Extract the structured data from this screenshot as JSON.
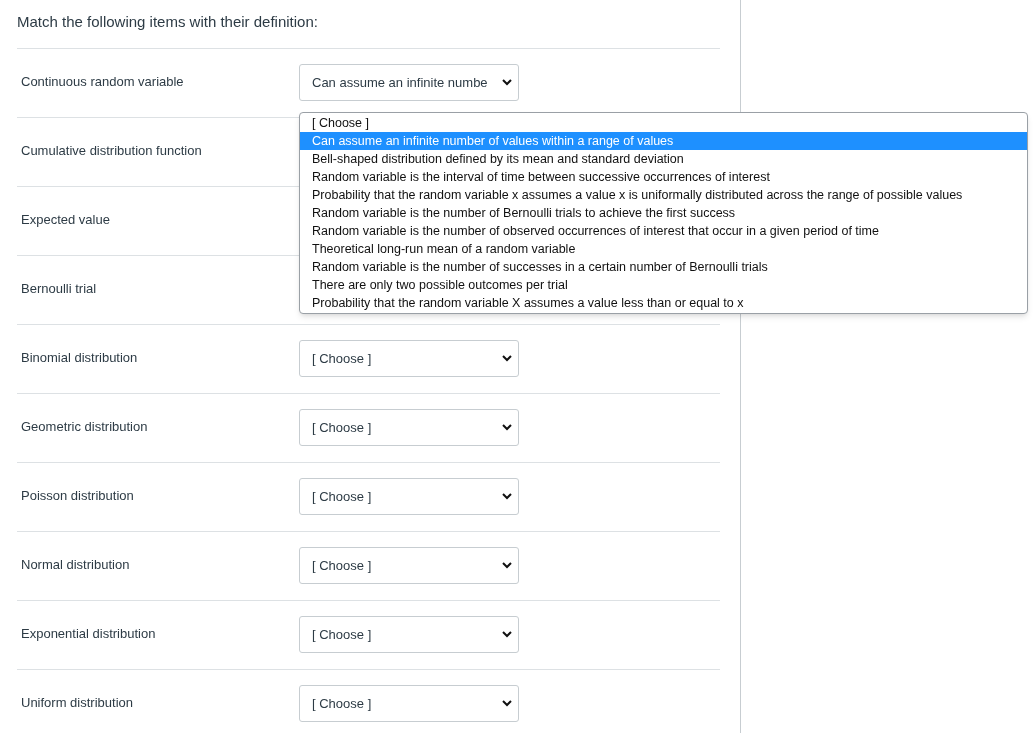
{
  "question": "Match the following items with their definition:",
  "items": [
    {
      "label": "Continuous random variable",
      "kind": "select",
      "value": "Can assume an infinite numbe"
    },
    {
      "label": "Cumulative distribution function",
      "kind": "covered"
    },
    {
      "label": "Expected value",
      "kind": "covered"
    },
    {
      "label": "Bernoulli trial",
      "kind": "covered"
    },
    {
      "label": "Binomial distribution",
      "kind": "select",
      "value": "[ Choose ]"
    },
    {
      "label": "Geometric distribution",
      "kind": "select",
      "value": "[ Choose ]"
    },
    {
      "label": "Poisson distribution",
      "kind": "select",
      "value": "[ Choose ]"
    },
    {
      "label": "Normal distribution",
      "kind": "select",
      "value": "[ Choose ]"
    },
    {
      "label": "Exponential distribution",
      "kind": "select",
      "value": "[ Choose ]"
    },
    {
      "label": "Uniform distribution",
      "kind": "select",
      "value": "[ Choose ]"
    }
  ],
  "dropdown": {
    "options": [
      {
        "text": "[ Choose ]",
        "selected": false
      },
      {
        "text": "Can assume an infinite number of values within a range of values",
        "selected": true
      },
      {
        "text": "Bell-shaped distribution defined by its mean and standard deviation",
        "selected": false
      },
      {
        "text": "Random variable is the interval of time between successive occurrences of interest",
        "selected": false
      },
      {
        "text": "Probability that the random variable x assumes a value x is uniformally distributed across the range of possible values",
        "selected": false
      },
      {
        "text": "Random variable is the number of Bernoulli trials to achieve the first success",
        "selected": false
      },
      {
        "text": "Random variable is the number of observed occurrences of interest that occur in a given period of time",
        "selected": false
      },
      {
        "text": "Theoretical long-run mean of a random variable",
        "selected": false
      },
      {
        "text": "Random variable is the number of successes in a certain number of Bernoulli trials",
        "selected": false
      },
      {
        "text": "There are only two possible outcomes per trial",
        "selected": false
      },
      {
        "text": "Probability that the random variable X assumes a value less than or equal to x",
        "selected": false
      }
    ]
  }
}
